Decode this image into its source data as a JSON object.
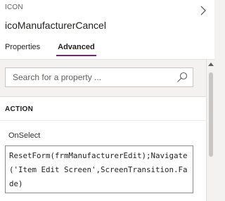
{
  "header": {
    "type_label": "ICON",
    "control_name": "icoManufacturerCancel"
  },
  "tabs": [
    {
      "label": "Properties",
      "active": false
    },
    {
      "label": "Advanced",
      "active": true
    }
  ],
  "search": {
    "placeholder": "Search for a property ...",
    "value": ""
  },
  "section": {
    "title": "ACTION"
  },
  "property": {
    "name": "OnSelect",
    "formula": "ResetForm(frmManufacturerEdit);Navigate('Item Edit Screen',ScreenTransition.Fade)"
  },
  "icons": {
    "header": "chevron-right-icon",
    "search": "search-icon",
    "scroll": "chevron-up-icon"
  },
  "colors": {
    "accent": "#742774",
    "panel_bg": "#f3f2f1",
    "text": "#201f1e"
  }
}
